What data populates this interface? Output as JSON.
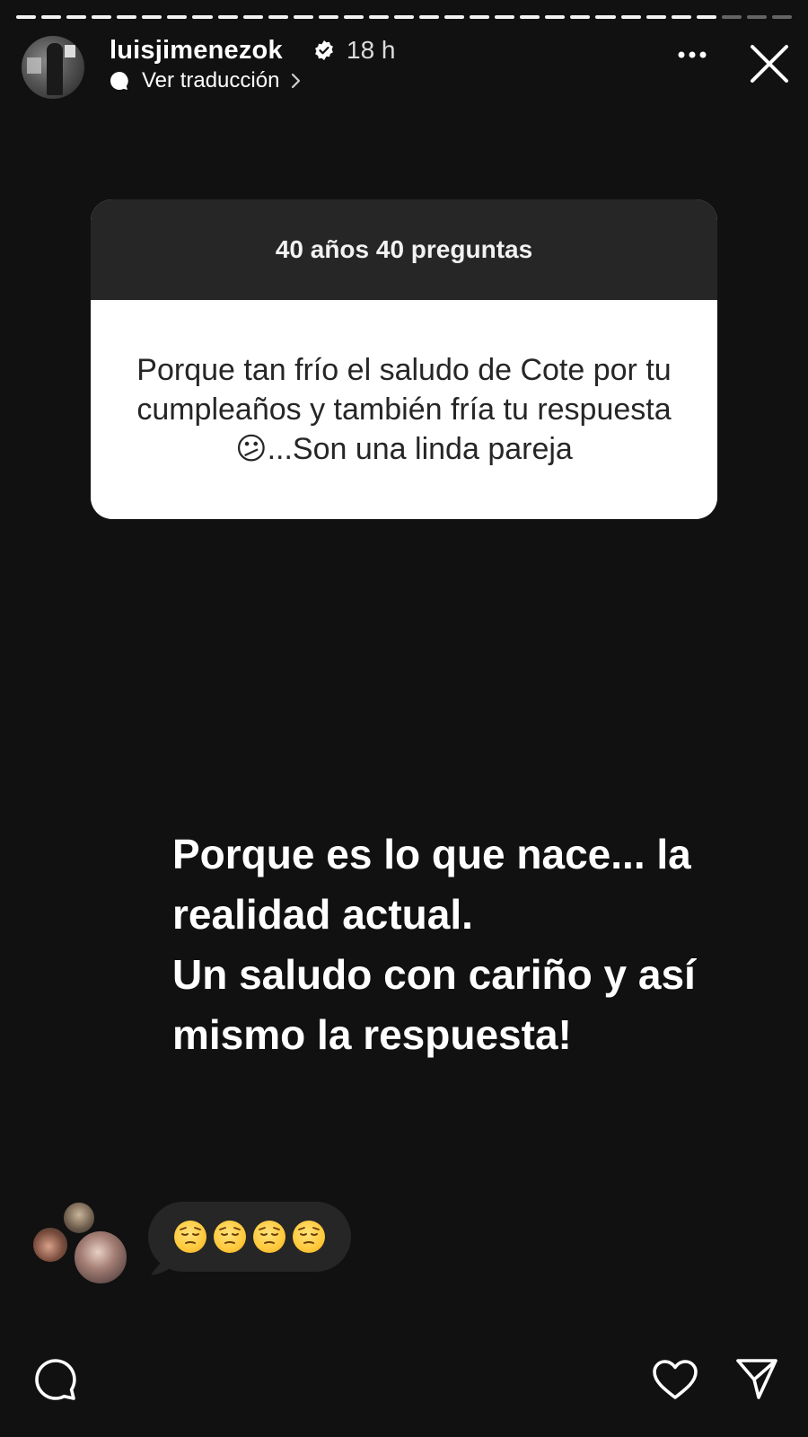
{
  "progress": {
    "segments": 31,
    "current_index": 28
  },
  "header": {
    "username": "luisjimenezok",
    "verified": true,
    "time": "18 h",
    "translate_label": "Ver traducción"
  },
  "question": {
    "title": "40 años 40 preguntas",
    "text": "Porque tan frío el saludo de Cote por tu cumpleaños y también fría tu respuesta 😕...Son una linda pareja"
  },
  "answer": {
    "line1": "Porque es lo que nace... la realidad actual.",
    "line2": "Un saludo con cariño y así mismo la respuesta!"
  },
  "reply": {
    "emojis": [
      "😔",
      "😔",
      "😔",
      "😔"
    ]
  },
  "icons": {
    "more": "more-icon",
    "close": "close-icon",
    "comment": "comment-icon",
    "like": "heart-icon",
    "share": "send-icon"
  }
}
